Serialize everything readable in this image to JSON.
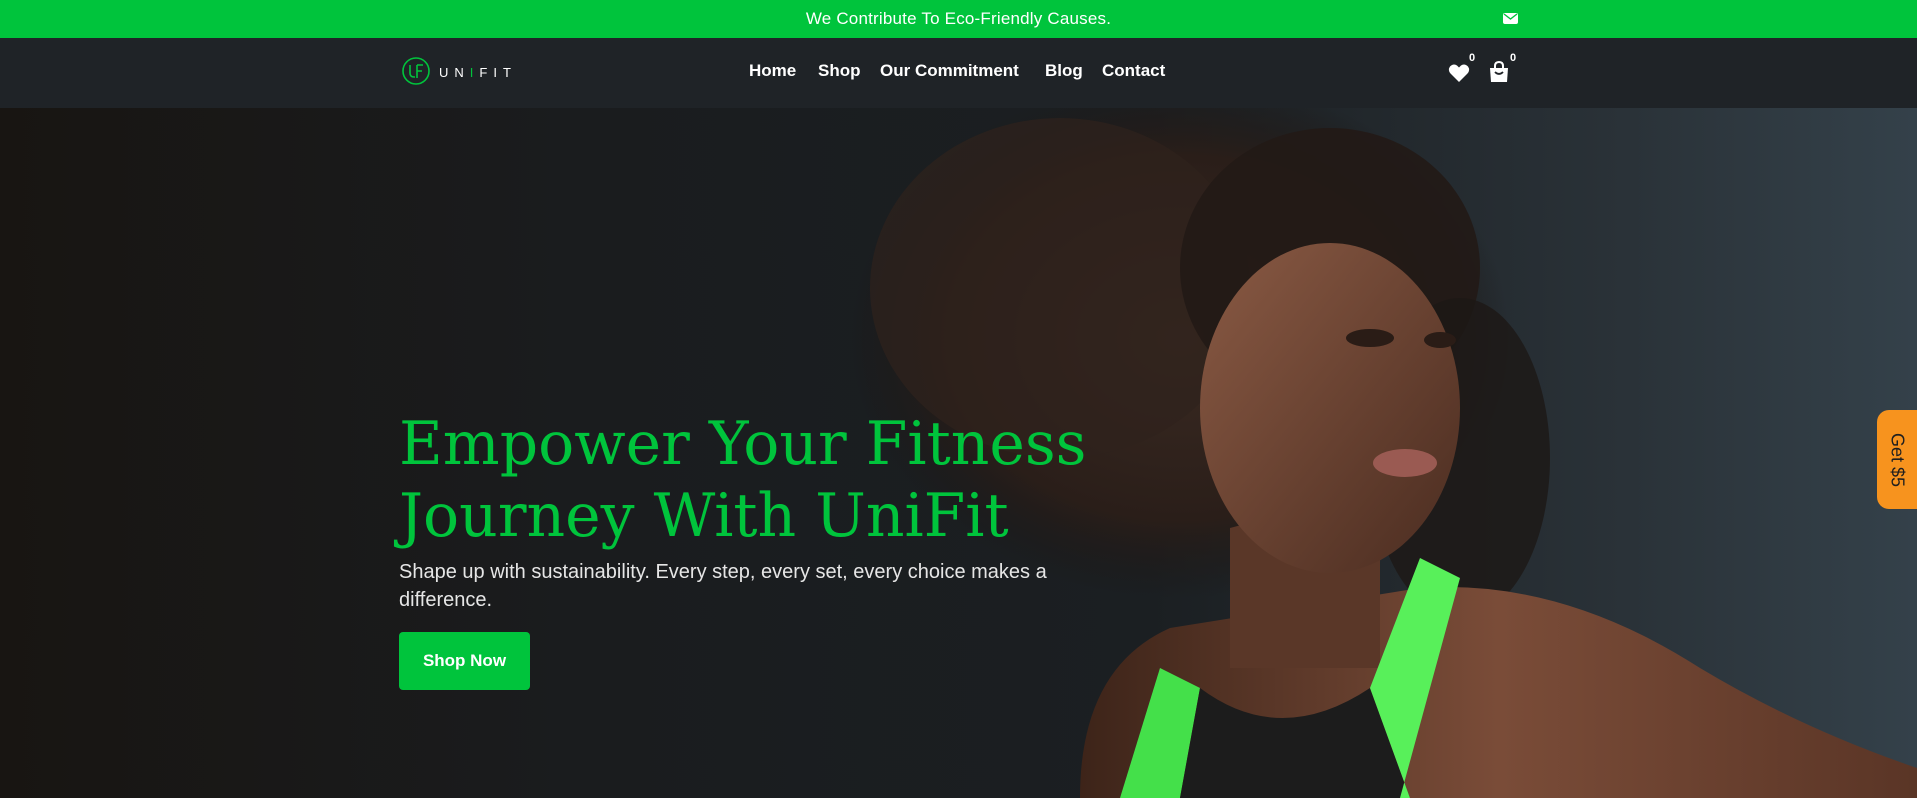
{
  "announcement": {
    "text": "We Contribute To Eco-Friendly Causes.",
    "icon": "mail-icon"
  },
  "brand": {
    "logo_mark": "UF",
    "name_parts": [
      "UN",
      "I",
      "FIT"
    ]
  },
  "nav": {
    "items": [
      {
        "label": "Home"
      },
      {
        "label": "Shop"
      },
      {
        "label": "Our Commitment"
      },
      {
        "label": "Blog"
      },
      {
        "label": "Contact"
      }
    ],
    "wishlist": {
      "icon": "heart-icon",
      "count": "0"
    },
    "cart": {
      "icon": "shopping-bag-icon",
      "count": "0"
    }
  },
  "hero": {
    "title_line1": "Empower Your Fitness",
    "title_line2": "Journey With UniFit",
    "subtitle": "Shape up with sustainability. Every step, every set, every choice makes a difference.",
    "cta_label": "Shop Now"
  },
  "promo_tab": {
    "label": "Get $5"
  },
  "colors": {
    "accent_green": "#00c43c",
    "nav_bg": "#1f2327",
    "promo_orange": "#f7931e"
  }
}
